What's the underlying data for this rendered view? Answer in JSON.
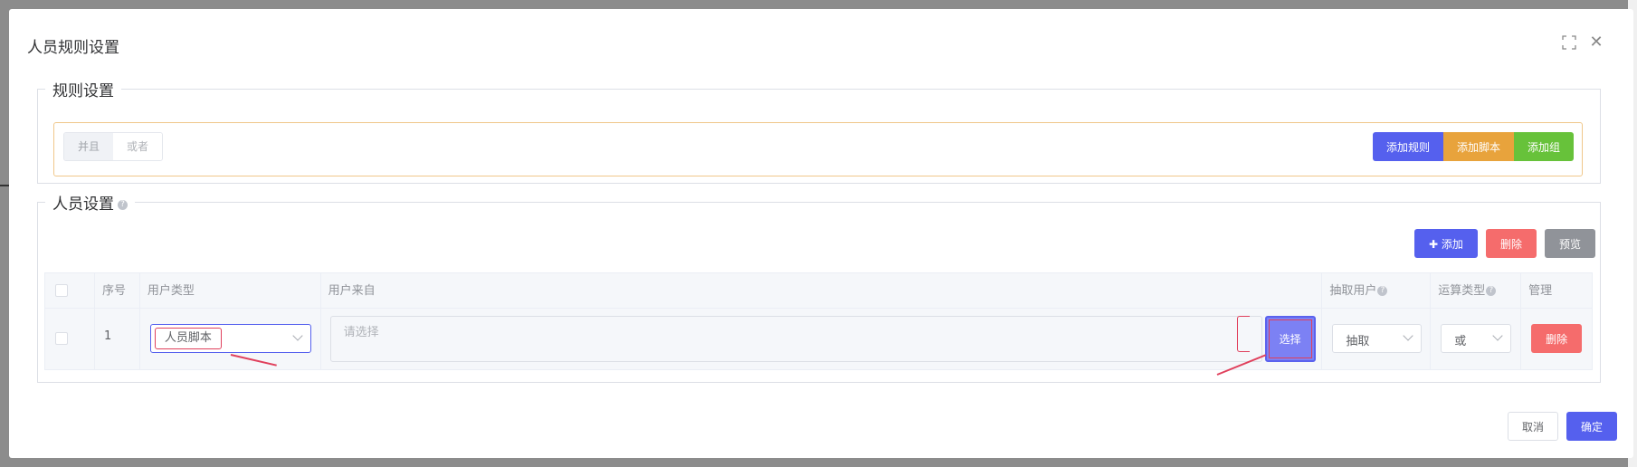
{
  "dialog": {
    "title": "人员规则设置"
  },
  "rule_section": {
    "legend": "规则设置",
    "logic_toggle": [
      "并且",
      "或者"
    ],
    "buttons": {
      "add_rule": "添加规则",
      "add_script": "添加脚本",
      "add_group": "添加组"
    }
  },
  "person_section": {
    "legend": "人员设置",
    "buttons": {
      "add": "添加",
      "delete": "删除",
      "preview": "预览"
    },
    "table": {
      "headers": [
        "序号",
        "用户类型",
        "用户来自",
        "抽取用户",
        "运算类型",
        "管理"
      ],
      "rows": [
        {
          "index": "1",
          "user_type": "人员脚本",
          "source_placeholder": "请选择",
          "select_button": "选择",
          "extract": "抽取",
          "operation": "或",
          "delete_button": "删除"
        }
      ]
    }
  },
  "footer": {
    "cancel": "取消",
    "confirm": "确定"
  },
  "colors": {
    "primary": "#5560ee",
    "warning": "#e8a33c",
    "success": "#67c23a",
    "danger": "#f56c6c",
    "info": "#909399"
  },
  "icons": [
    "fullscreen-icon",
    "close-icon",
    "question-icon",
    "plus-icon",
    "chevron-down-icon"
  ]
}
